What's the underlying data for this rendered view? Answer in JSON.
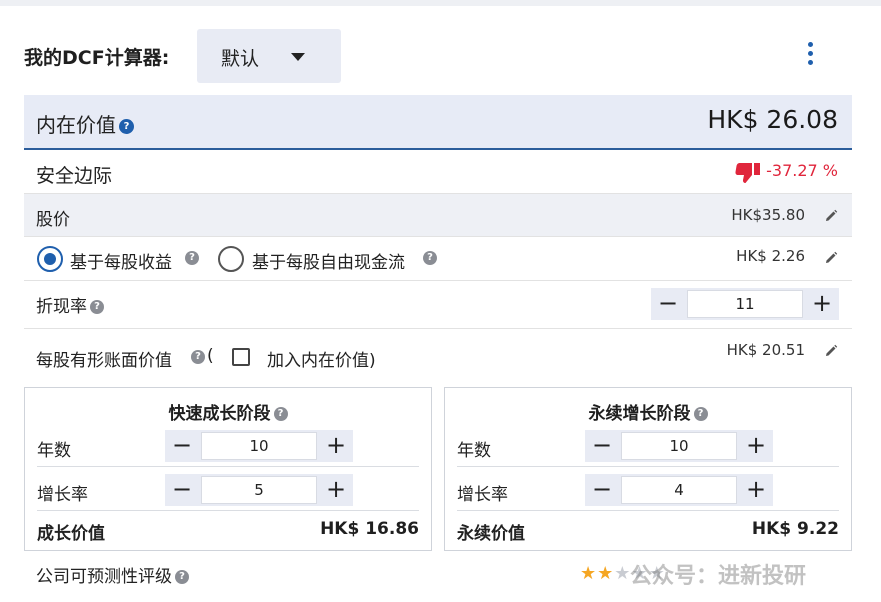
{
  "header": {
    "title": "我的DCF计算器:",
    "preset": "默认",
    "accent": "#1f5fad"
  },
  "intrinsic": {
    "label": "内在价值",
    "value": "HK$ 26.08"
  },
  "margin_of_safety": {
    "label": "安全边际",
    "value": "-37.27 %",
    "color": "#e0263c",
    "icon": "thumbs-down-icon"
  },
  "share_price": {
    "label": "股价",
    "value": "HK$35.80"
  },
  "basis": {
    "option_eps": "基于每股收益",
    "option_fcf": "基于每股自由现金流",
    "selected": "eps",
    "value": "HK$ 2.26"
  },
  "discount_rate": {
    "label": "折现率",
    "value": "11"
  },
  "book_value": {
    "label": "每股有形账面价值",
    "open_paren": "(",
    "checkbox_label": "加入内在价值)",
    "value": "HK$ 20.51",
    "checked": false
  },
  "fast_growth": {
    "title": "快速成长阶段",
    "years_label": "年数",
    "years": "10",
    "rate_label": "增长率",
    "rate": "5",
    "value_label": "成长价值",
    "value": "HK$ 16.86"
  },
  "terminal_growth": {
    "title": "永续增长阶段",
    "years_label": "年数",
    "years": "10",
    "rate_label": "增长率",
    "rate": "4",
    "value_label": "永续价值",
    "value": "HK$ 9.22"
  },
  "predictability": {
    "label": "公司可预测性评级",
    "rating": 2,
    "max": 5
  },
  "watermark": "公众号：进新投研"
}
